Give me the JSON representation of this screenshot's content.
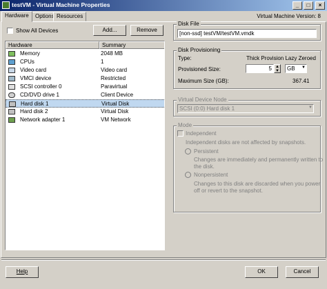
{
  "window": {
    "title": "testVM - Virtual Machine Properties",
    "minimize_glyph": "_",
    "maximize_glyph": "□",
    "close_glyph": "×",
    "app_icon": "vm-icon"
  },
  "tabs": [
    "Hardware",
    "Options",
    "Resources"
  ],
  "vm_version": "Virtual Machine Version: 8",
  "left": {
    "show_all_devices": "Show All Devices",
    "add_button": "Add...",
    "remove_button": "Remove",
    "columns": [
      "Hardware",
      "Summary"
    ],
    "rows": [
      {
        "name": "Memory",
        "summary": "2048 MB",
        "icon": "memory-icon"
      },
      {
        "name": "CPUs",
        "summary": "1",
        "icon": "cpu-icon"
      },
      {
        "name": "Video card",
        "summary": "Video card",
        "icon": "video-card-icon"
      },
      {
        "name": "VMCI device",
        "summary": "Restricted",
        "icon": "vmci-icon"
      },
      {
        "name": "SCSI controller 0",
        "summary": "Paravirtual",
        "icon": "scsi-icon"
      },
      {
        "name": "CD/DVD drive 1",
        "summary": "Client Device",
        "icon": "cd-dvd-icon"
      },
      {
        "name": "Hard disk 1",
        "summary": "Virtual Disk",
        "icon": "hard-disk-icon"
      },
      {
        "name": "Hard disk 2",
        "summary": "Virtual Disk",
        "icon": "hard-disk-icon"
      },
      {
        "name": "Network adapter 1",
        "summary": "VM Network",
        "icon": "network-adapter-icon"
      }
    ],
    "selected_row": "Hard disk 1"
  },
  "disk_file": {
    "title": "Disk File",
    "value": "[non-ssd] testVM/testVM.vmdk"
  },
  "provisioning": {
    "title": "Disk Provisioning",
    "type_label": "Type:",
    "type_value": "Thick Provision Lazy Zeroed",
    "size_label": "Provisioned Size:",
    "size_value": "5",
    "size_unit": "GB",
    "max_label": "Maximum Size (GB):",
    "max_value": "367.41"
  },
  "vdn": {
    "title": "Virtual Device Node",
    "value": "SCSI (0:0) Hard disk 1"
  },
  "mode": {
    "title": "Mode",
    "independent": "Independent",
    "independent_desc": "Independent disks are not affected by snapshots.",
    "persistent": "Persistent",
    "persistent_desc1": "Changes are immediately and permanently written to",
    "persistent_desc2": "the disk.",
    "nonpersistent": "Nonpersistent",
    "nonpersistent_desc1": "Changes to this disk are discarded when you power",
    "nonpersistent_desc2": "off or revert to the snapshot."
  },
  "footer": {
    "help": "Help",
    "ok": "OK",
    "cancel": "Cancel"
  }
}
